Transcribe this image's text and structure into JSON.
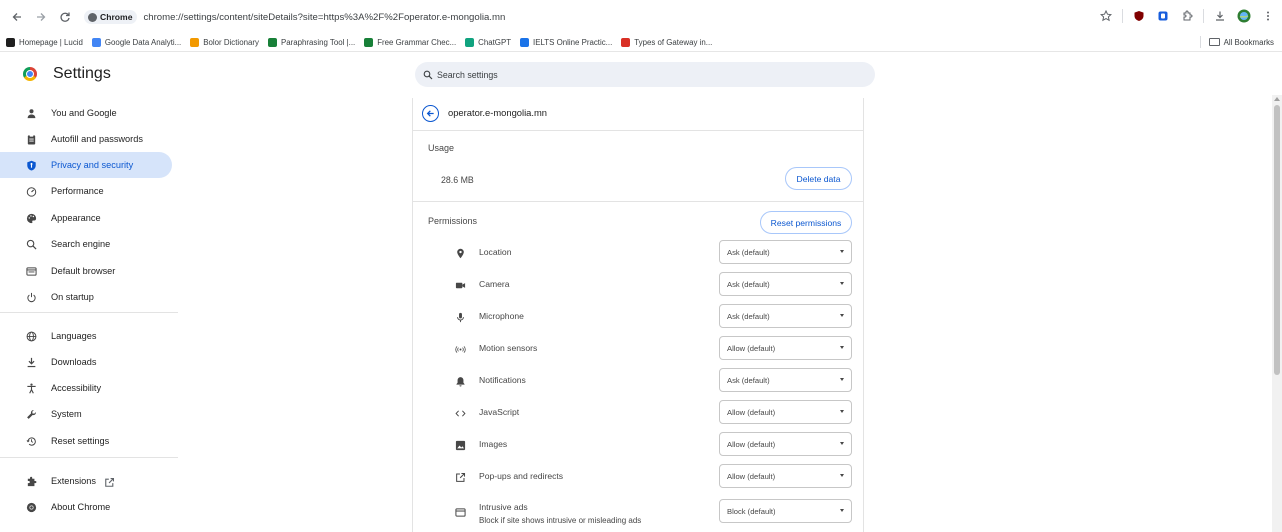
{
  "toolbar": {
    "chip_label": "Chrome",
    "url": "chrome://settings/content/siteDetails?site=https%3A%2F%2Foperator.e-mongolia.mn"
  },
  "bookmarks": {
    "items": [
      {
        "label": "Homepage | Lucid",
        "color": "#1f1f1f"
      },
      {
        "label": "Google Data Analyti...",
        "color": "#4285f4"
      },
      {
        "label": "Bolor Dictionary",
        "color": "#f29900"
      },
      {
        "label": "Paraphrasing Tool |...",
        "color": "#188038"
      },
      {
        "label": "Free Grammar Chec...",
        "color": "#188038"
      },
      {
        "label": "ChatGPT",
        "color": "#10a37f"
      },
      {
        "label": "IELTS Online Practic...",
        "color": "#1a73e8"
      },
      {
        "label": "Types of Gateway in...",
        "color": "#d93025"
      }
    ],
    "all_bookmarks": "All Bookmarks"
  },
  "header": {
    "title": "Settings",
    "search_placeholder": "Search settings"
  },
  "sidebar": {
    "items": [
      {
        "label": "You and Google",
        "icon": "person-icon"
      },
      {
        "label": "Autofill and passwords",
        "icon": "clipboard-icon"
      },
      {
        "label": "Privacy and security",
        "icon": "shield-icon",
        "active": true
      },
      {
        "label": "Performance",
        "icon": "speedometer-icon"
      },
      {
        "label": "Appearance",
        "icon": "palette-icon"
      },
      {
        "label": "Search engine",
        "icon": "search-icon"
      },
      {
        "label": "Default browser",
        "icon": "browser-window-icon"
      },
      {
        "label": "On startup",
        "icon": "power-icon"
      },
      {
        "label": "Languages",
        "icon": "globe-icon"
      },
      {
        "label": "Downloads",
        "icon": "download-icon"
      },
      {
        "label": "Accessibility",
        "icon": "accessibility-icon"
      },
      {
        "label": "System",
        "icon": "wrench-icon"
      },
      {
        "label": "Reset settings",
        "icon": "history-icon"
      },
      {
        "label": "Extensions",
        "icon": "puzzle-icon"
      },
      {
        "label": "About Chrome",
        "icon": "chrome-icon"
      }
    ]
  },
  "site": {
    "name": "operator.e-mongolia.mn",
    "usage_label": "Usage",
    "usage_value": "28.6 MB",
    "delete_button": "Delete data",
    "permissions_label": "Permissions",
    "reset_button": "Reset permissions"
  },
  "permissions": [
    {
      "label": "Location",
      "value": "Ask (default)",
      "icon": "location-pin-icon"
    },
    {
      "label": "Camera",
      "value": "Ask (default)",
      "icon": "camera-icon"
    },
    {
      "label": "Microphone",
      "value": "Ask (default)",
      "icon": "microphone-icon"
    },
    {
      "label": "Motion sensors",
      "value": "Allow (default)",
      "icon": "motion-sensor-icon"
    },
    {
      "label": "Notifications",
      "value": "Ask (default)",
      "icon": "bell-icon"
    },
    {
      "label": "JavaScript",
      "value": "Allow (default)",
      "icon": "code-icon"
    },
    {
      "label": "Images",
      "value": "Allow (default)",
      "icon": "image-icon"
    },
    {
      "label": "Pop-ups and redirects",
      "value": "Allow (default)",
      "icon": "popup-icon"
    },
    {
      "label": "Intrusive ads",
      "sublabel": "Block if site shows intrusive or misleading ads",
      "value": "Block (default)",
      "icon": "ads-icon"
    }
  ],
  "colors": {
    "accent": "#0b57d0",
    "active_bg": "#d6e4fa",
    "search_bg": "#edf0f6"
  }
}
